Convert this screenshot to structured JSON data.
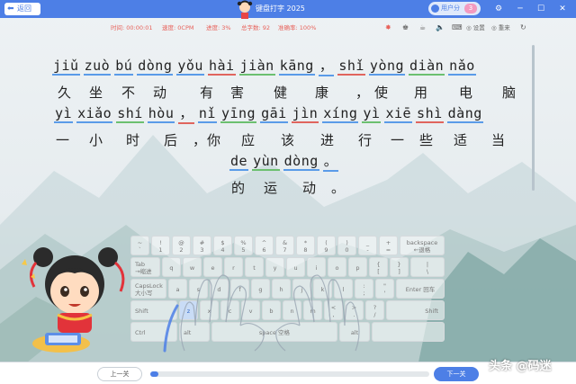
{
  "app": {
    "title": "键盘打字 2025"
  },
  "titlebar": {
    "back_label": "返回",
    "user_name": "用户分",
    "user_badge": "3",
    "icons": [
      "gear-icon",
      "minimize-icon",
      "maximize-icon",
      "close-icon"
    ]
  },
  "stats": {
    "time_label": "时间:",
    "time_value": "00:00:01",
    "speed_label": "速度:",
    "speed_value": "0CPM",
    "progress_label": "进度:",
    "progress_value": "3%",
    "total_label": "总字数:",
    "total_value": "92",
    "accuracy_label": "准确率:",
    "accuracy_value": "100%"
  },
  "toolbar": {
    "settings_label": "设置",
    "restart_label": "重来",
    "icons": [
      "bomb-icon",
      "shirt-icon",
      "cup-icon",
      "volume-icon",
      "keyboard-icon",
      "gear-icon",
      "restart-icon",
      "refresh-icon"
    ]
  },
  "lesson": {
    "pinyin1": [
      "jiǔ",
      "zuò",
      "bú",
      "dòng",
      "yǒu",
      "hài",
      "jiàn",
      "kāng",
      "，",
      "shǐ",
      "yòng",
      "diàn",
      "nǎo"
    ],
    "hanzi1": [
      "久",
      "坐",
      "不",
      "动",
      "有",
      "害",
      "健",
      "康",
      "，",
      "使",
      "用",
      "电",
      "脑"
    ],
    "pinyin2": [
      "yì",
      "xiǎo",
      "shí",
      "hòu",
      "，",
      "nǐ",
      "yīng",
      "gāi",
      "jìn",
      "xíng",
      "yì",
      "xiē",
      "shì",
      "dàng"
    ],
    "hanzi2": [
      "一",
      "小",
      "时",
      "后",
      "，",
      "你",
      "应",
      "该",
      "进",
      "行",
      "一",
      "些",
      "适",
      "当"
    ],
    "pinyin3": [
      "de",
      "yùn",
      "dòng",
      "。"
    ],
    "hanzi3": [
      "的",
      "运",
      "动",
      "。"
    ]
  },
  "keyboard": {
    "active_key": "z",
    "row1": [
      "~\n`",
      "!\n1",
      "@\n2",
      "#\n3",
      "$\n4",
      "%\n5",
      "^\n6",
      "&\n7",
      "*\n8",
      "(\n9",
      ")\n0",
      "_\n-",
      "+\n="
    ],
    "backspace": "backspace\n←退格",
    "tab": "Tab\n→缩进",
    "row2": [
      "q",
      "w",
      "e",
      "r",
      "t",
      "y",
      "u",
      "i",
      "o",
      "p",
      "{\n[",
      "}\n]",
      "|\n\\"
    ],
    "capslock": "CapsLock\n大小写",
    "row3": [
      "a",
      "s",
      "d",
      "f",
      "g",
      "h",
      "j",
      "k",
      "l",
      ":\n;",
      "\"\n'"
    ],
    "enter": "Enter 回车",
    "shift_left": "Shift",
    "row4": [
      "z",
      "x",
      "c",
      "v",
      "b",
      "n",
      "m",
      "<\n,",
      ">\n.",
      "?\n/"
    ],
    "shift_right": "Shift",
    "ctrl": "Ctrl",
    "alt_left": "alt",
    "space": "space 空格",
    "alt_right": "alt"
  },
  "bottom": {
    "prev_label": "上一关",
    "next_label": "下一关",
    "progress_fraction": 0.03
  },
  "watermark": "头条 @码迷",
  "colors": {
    "accent": "#4d7fe6",
    "stat": "#e8625b"
  }
}
